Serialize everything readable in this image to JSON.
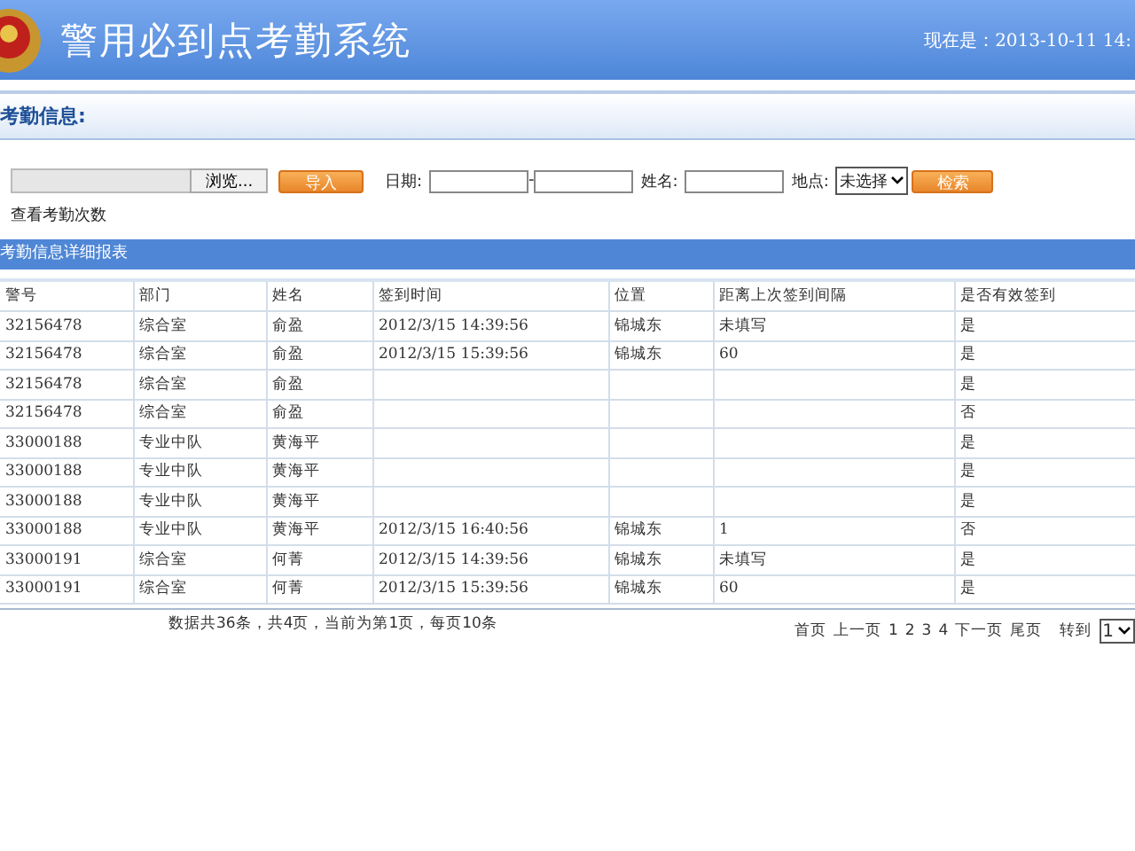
{
  "header": {
    "title": "警用必到点考勤系统",
    "clock": "现在是：2013-10-11 14:"
  },
  "section": {
    "title": "考勤信息:"
  },
  "form": {
    "browse_button": "浏览...",
    "import_button": "导入",
    "date_label": "日期:",
    "date_separator": "-",
    "name_label": "姓名:",
    "place_label": "地点:",
    "place_select": "未选择",
    "search_button": "检索",
    "link": "查看考勤次数"
  },
  "report": {
    "title": "考勤信息详细报表",
    "columns": [
      "警号",
      "部门",
      "姓名",
      "签到时间",
      "位置",
      "距离上次签到间隔",
      "是否有效签到"
    ],
    "rows": [
      [
        "32156478",
        "综合室",
        "俞盈",
        "2012/3/15 14:39:56",
        "锦城东",
        "未填写",
        "是"
      ],
      [
        "32156478",
        "综合室",
        "俞盈",
        "2012/3/15 15:39:56",
        "锦城东",
        "60",
        "是"
      ],
      [
        "32156478",
        "综合室",
        "俞盈",
        null,
        null,
        null,
        "是"
      ],
      [
        "32156478",
        "综合室",
        "俞盈",
        null,
        null,
        null,
        "否"
      ],
      [
        "33000188",
        "专业中队",
        "黄海平",
        null,
        null,
        null,
        "是"
      ],
      [
        "33000188",
        "专业中队",
        "黄海平",
        null,
        null,
        null,
        "是"
      ],
      [
        "33000188",
        "专业中队",
        "黄海平",
        null,
        null,
        null,
        "是"
      ],
      [
        "33000188",
        "专业中队",
        "黄海平",
        "2012/3/15 16:40:56",
        "锦城东",
        "1",
        "否"
      ],
      [
        "33000191",
        "综合室",
        "何菁",
        "2012/3/15 14:39:56",
        "锦城东",
        "未填写",
        "是"
      ],
      [
        "33000191",
        "综合室",
        "何菁",
        "2012/3/15 15:39:56",
        "锦城东",
        "60",
        "是"
      ]
    ]
  },
  "pager": {
    "summary": "数据共36条，共4页，当前为第1页，每页10条",
    "first": "首页",
    "prev": "上一页",
    "pages": [
      "1",
      "2",
      "3",
      "4"
    ],
    "next": "下一页",
    "last": "尾页",
    "goto_label": "转到",
    "goto_select": "1"
  }
}
